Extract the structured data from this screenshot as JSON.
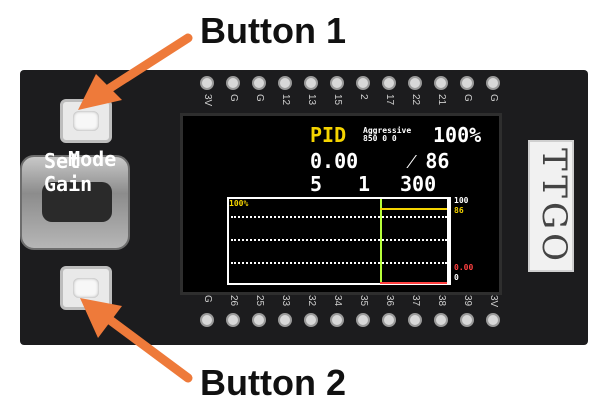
{
  "callouts": {
    "button1": "Button 1",
    "button2": "Button 2"
  },
  "board": {
    "label": "TTGO",
    "top_pins": [
      "3V",
      "G",
      "G",
      "12",
      "13",
      "15",
      "2",
      "17",
      "22",
      "21",
      "G",
      "G"
    ],
    "bottom_pins": [
      "G",
      "26",
      "25",
      "33",
      "32",
      "34",
      "35",
      "36",
      "37",
      "38",
      "39",
      "3V"
    ]
  },
  "display": {
    "mode_label": "Mode",
    "mode_value": "PID",
    "mode_detail_line1": "Aggressive",
    "mode_detail_line2": "850 0 0",
    "mode_percent": "100%",
    "set_label": "Set",
    "set_value": "0.00",
    "set_target": "⁄ 86",
    "gain_label": "Gain",
    "gain_p": "5",
    "gain_i": "1",
    "gain_d": "300",
    "graph": {
      "top_left_label": "100%",
      "right_top": "100",
      "right_mid": "86",
      "right_low": "0.00",
      "right_bottom": "0"
    }
  },
  "colors": {
    "accent_yellow": "#f5d400",
    "trace_green": "#b6ff3a",
    "alert_red": "#ff4040",
    "arrow_orange": "#ee7a3a"
  }
}
